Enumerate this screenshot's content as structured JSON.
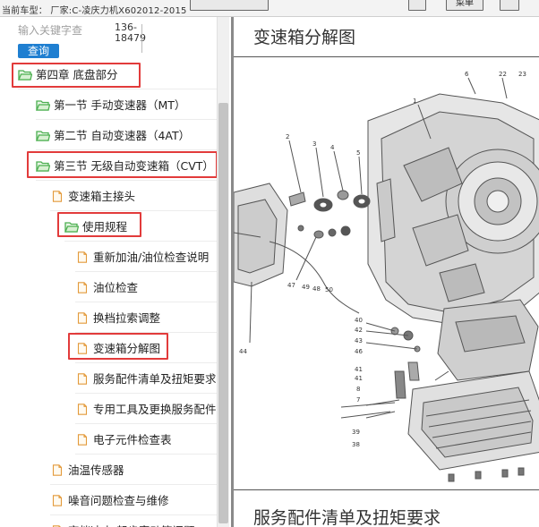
{
  "topbar": {
    "car_info": "当前车型：  厂家:C-凌庆力机X602012-2015",
    "mid_button": "菜单"
  },
  "sidebar": {
    "search_placeholder": "输入关键字查",
    "search_button": "查询",
    "phone": "136-18479",
    "tree": [
      {
        "label": "第四章 底盘部分",
        "icon": "folder-open-icon"
      },
      {
        "label": "第一节 手动变速器（MT）",
        "icon": "folder-open-icon"
      },
      {
        "label": "第二节 自动变速器（4AT）",
        "icon": "folder-open-icon"
      },
      {
        "label": "第三节 无级自动变速箱（CVT）",
        "icon": "folder-open-icon"
      },
      {
        "label": "变速箱主接头",
        "icon": "document-icon"
      },
      {
        "label": "使用规程",
        "icon": "folder-open-icon"
      },
      {
        "label": "重新加油/油位检查说明",
        "icon": "document-icon"
      },
      {
        "label": "油位检查",
        "icon": "document-icon"
      },
      {
        "label": "换档拉索调整",
        "icon": "document-icon"
      },
      {
        "label": "变速箱分解图",
        "icon": "document-icon"
      },
      {
        "label": "服务配件清单及扭矩要求",
        "icon": "document-icon"
      },
      {
        "label": "专用工具及更换服务配件",
        "icon": "document-icon"
      },
      {
        "label": "电子元件检查表",
        "icon": "document-icon"
      },
      {
        "label": "油温传感器",
        "icon": "document-icon"
      },
      {
        "label": "噪音问题检查与维修",
        "icon": "document-icon"
      },
      {
        "label": "变档冲击 起步窜动等问题",
        "icon": "document-icon"
      }
    ]
  },
  "content": {
    "title": "变速箱分解图",
    "next_section_title": "服务配件清单及扭矩要求",
    "callouts": [
      "1",
      "2",
      "3",
      "4",
      "5",
      "6",
      "7",
      "8",
      "22",
      "23",
      "38",
      "39",
      "40",
      "41",
      "42",
      "43",
      "44",
      "46",
      "47",
      "48",
      "49",
      "50"
    ]
  },
  "colors": {
    "highlight": "#e23b3b",
    "folder": "#4caf50",
    "search_button": "#1f7fd1"
  }
}
